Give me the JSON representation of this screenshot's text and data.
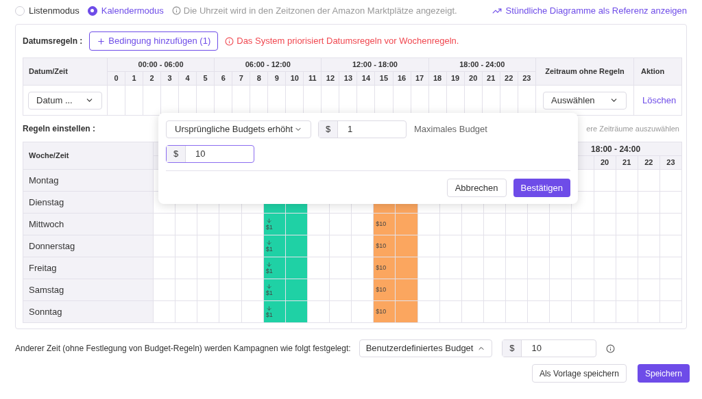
{
  "modes": [
    {
      "label": "Listenmodus",
      "selected": false
    },
    {
      "label": "Kalendermodus",
      "selected": true
    }
  ],
  "timezone_note": "Die Uhrzeit wird in den Zeitzonen der Amazon Marktplätze angezeigt.",
  "chart_link": "Stündliche Diagramme als Referenz anzeigen",
  "date_rules": {
    "label": "Datumsregeln :",
    "add_button": "Bedingung hinzufügen (1)",
    "warning": "Das System priorisiert Datumsregeln vor Wochenregeln.",
    "table": {
      "first_column": "Datum/Zeit",
      "groups": [
        "00:00 - 06:00",
        "06:00 - 12:00",
        "12:00 - 18:00",
        "18:00 - 24:00"
      ],
      "hours": [
        "0",
        "1",
        "2",
        "3",
        "4",
        "5",
        "6",
        "7",
        "8",
        "9",
        "10",
        "11",
        "12",
        "13",
        "14",
        "15",
        "16",
        "17",
        "18",
        "19",
        "20",
        "21",
        "22",
        "23"
      ],
      "range_column": "Zeitraum ohne Regeln",
      "action_column": "Aktion",
      "rows": [
        {
          "date": "Datum ...",
          "range": "Auswählen",
          "action": "Löschen"
        }
      ]
    }
  },
  "week_rules": {
    "label": "Regeln einstellen :",
    "hint": "ere Zeiträume auszuwählen",
    "first_column": "Woche/Zeit",
    "group_labels": [
      "18:00 - 24:00"
    ],
    "hour_labels": [
      "20",
      "21",
      "22",
      "23"
    ],
    "columns": [
      {
        "kind": "empty"
      },
      {
        "kind": "empty"
      },
      {
        "kind": "empty"
      },
      {
        "kind": "empty"
      },
      {
        "kind": "empty"
      },
      {
        "kind": "decrease",
        "color": "#1fd1a5"
      },
      {
        "kind": "decrease",
        "color": "#1fd1a5"
      },
      {
        "kind": "empty"
      },
      {
        "kind": "empty"
      },
      {
        "kind": "empty"
      },
      {
        "kind": "fixed",
        "color": "#fba65f"
      },
      {
        "kind": "fixed",
        "color": "#fba65f"
      },
      {
        "kind": "empty"
      },
      {
        "kind": "empty"
      },
      {
        "kind": "empty"
      },
      {
        "kind": "empty"
      },
      {
        "kind": "empty"
      },
      {
        "kind": "empty"
      },
      {
        "kind": "empty"
      },
      {
        "kind": "empty"
      },
      {
        "kind": "empty"
      },
      {
        "kind": "empty"
      },
      {
        "kind": "empty"
      },
      {
        "kind": "empty"
      }
    ],
    "days": [
      {
        "name": "Montag"
      },
      {
        "name": "Dienstag"
      },
      {
        "name": "Mittwoch",
        "labels": [
          "$1",
          "$10"
        ]
      },
      {
        "name": "Donnerstag",
        "labels": [
          "$1",
          "$10"
        ]
      },
      {
        "name": "Freitag",
        "labels": [
          "$1",
          "$10"
        ]
      },
      {
        "name": "Samstag",
        "labels": [
          "$1",
          "$10"
        ]
      },
      {
        "name": "Sonntag",
        "labels": [
          "$1",
          "$10"
        ]
      }
    ]
  },
  "popover": {
    "mode_select": "Ursprüngliche Budgets erhöht",
    "currency": "$",
    "amount": "1",
    "max_label": "Maximales Budget",
    "max_currency": "$",
    "max_amount": "10",
    "cancel": "Abbrechen",
    "confirm": "Bestätigen"
  },
  "other_time": {
    "label": "Anderer Zeit (ohne Festlegung von Budget-Regeln) werden Kampagnen wie folgt festgelegt:",
    "select": "Benutzerdefiniertes Budget",
    "currency": "$",
    "amount": "10"
  },
  "footer": {
    "template_button": "Als Vorlage speichern",
    "save_button": "Speichern"
  }
}
